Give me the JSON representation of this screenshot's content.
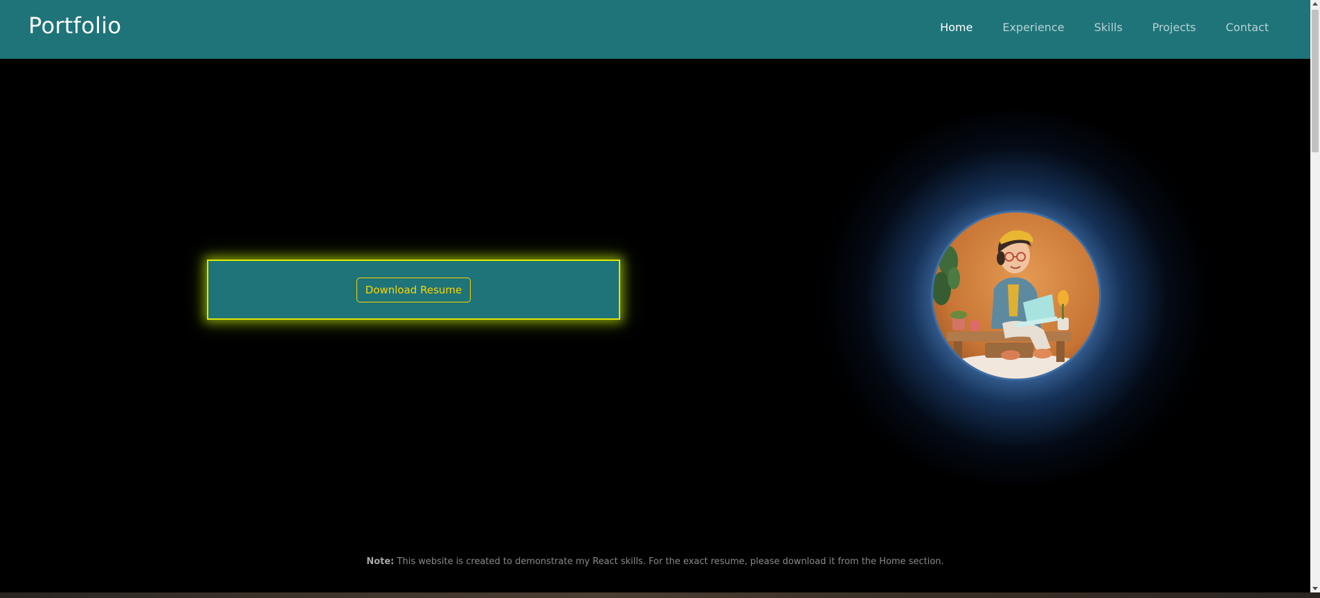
{
  "navbar": {
    "brand": "Portfolio",
    "links": [
      {
        "label": "Home",
        "active": true
      },
      {
        "label": "Experience",
        "active": false
      },
      {
        "label": "Skills",
        "active": false
      },
      {
        "label": "Projects",
        "active": false
      },
      {
        "label": "Contact",
        "active": false
      }
    ]
  },
  "hero": {
    "download_label": "Download Resume",
    "avatar_icon": "developer-avatar-illustration"
  },
  "footer": {
    "note_label": "Note:",
    "note_text": " This website is created to demonstrate my React skills. For the exact resume, please download it from the Home section."
  },
  "colors": {
    "navbar_bg": "#1e7479",
    "page_bg": "#000000",
    "button_text": "#ffd400",
    "card_border": "#e0e800",
    "avatar_glow": "#5a96dc"
  }
}
